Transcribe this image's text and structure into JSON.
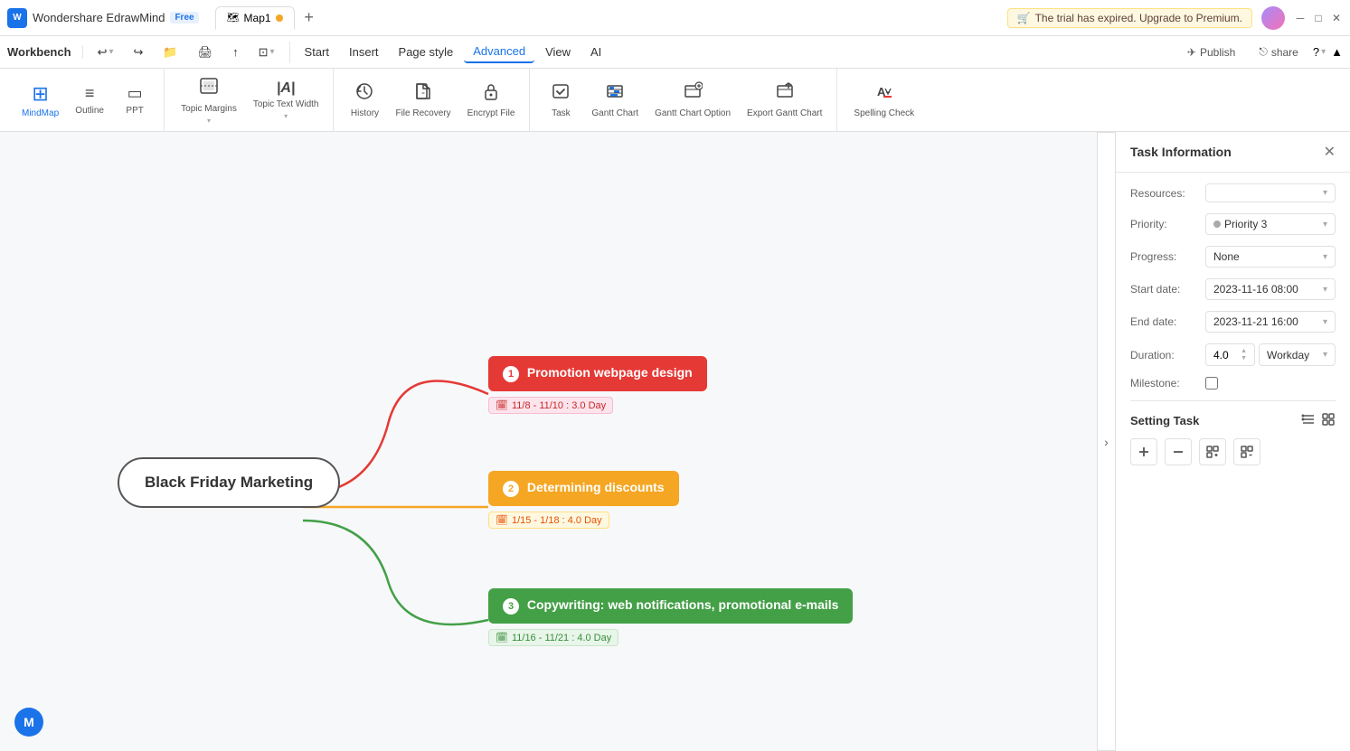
{
  "app": {
    "name": "Wondershare EdrawMind",
    "badge": "Free",
    "tab": "Map1",
    "trial_text": "The trial has expired. Upgrade to Premium."
  },
  "menubar": {
    "items": [
      "Start",
      "Insert",
      "Page style",
      "Advanced",
      "View",
      "AI"
    ],
    "active": "Advanced",
    "publish": "Publish",
    "share": "share"
  },
  "toolbar": {
    "view_group": [
      {
        "id": "mindmap",
        "icon": "⊞",
        "label": "MindMap"
      },
      {
        "id": "outline",
        "icon": "≡",
        "label": "Outline"
      },
      {
        "id": "ppt",
        "icon": "▭",
        "label": "PPT"
      }
    ],
    "format_group": [
      {
        "id": "topic-margins",
        "icon": "⊞",
        "label": "Topic Margins"
      },
      {
        "id": "topic-text-width",
        "icon": "|A|",
        "label": "Topic Text Width"
      }
    ],
    "file_group": [
      {
        "id": "history",
        "icon": "⟳",
        "label": "History"
      },
      {
        "id": "file-recovery",
        "icon": "🗂",
        "label": "File Recovery"
      },
      {
        "id": "encrypt-file",
        "icon": "🔒",
        "label": "Encrypt File"
      }
    ],
    "task_group": [
      {
        "id": "task",
        "icon": "☑",
        "label": "Task"
      },
      {
        "id": "gantt-chart",
        "icon": "📊",
        "label": "Gantt Chart"
      },
      {
        "id": "gantt-chart-option",
        "icon": "⚙",
        "label": "Gantt Chart Option"
      },
      {
        "id": "export-gantt-chart",
        "icon": "↗",
        "label": "Export Gantt Chart"
      }
    ],
    "check_group": [
      {
        "id": "spelling-check",
        "icon": "✓",
        "label": "Spelling Check"
      }
    ]
  },
  "mindmap": {
    "central_node": "Black Friday Marketing",
    "branches": [
      {
        "id": "branch1",
        "label": "Promotion webpage design",
        "color": "red",
        "num": "1",
        "date": "11/8 - 11/10 : 3.0 Day",
        "date_style": "red-bg"
      },
      {
        "id": "branch2",
        "label": "Determining discounts",
        "color": "orange",
        "num": "2",
        "date": "1/15 - 1/18 : 4.0 Day",
        "date_style": "orange-bg"
      },
      {
        "id": "branch3",
        "label": "Copywriting: web notifications, promotional e-mails",
        "color": "green",
        "num": "3",
        "date": "11/16 - 11/21 : 4.0 Day",
        "date_style": "green"
      }
    ]
  },
  "task_panel": {
    "title": "Task Information",
    "fields": [
      {
        "label": "Resources:",
        "value": "",
        "id": "resources"
      },
      {
        "label": "Priority:",
        "value": "Priority 3",
        "id": "priority"
      },
      {
        "label": "Progress:",
        "value": "None",
        "id": "progress"
      },
      {
        "label": "Start date:",
        "value": "2023-11-16   08:00",
        "id": "start-date"
      },
      {
        "label": "End date:",
        "value": "2023-11-21   16:00",
        "id": "end-date"
      },
      {
        "label": "Duration:",
        "value": "4.0",
        "id": "duration",
        "extra": "Workday"
      },
      {
        "label": "Milestone:",
        "value": "",
        "id": "milestone",
        "is_checkbox": true
      }
    ],
    "setting_task_label": "Setting Task",
    "setting_icons": [
      "≡",
      "⊡"
    ],
    "setting_buttons": [
      "+",
      "-",
      "⊞",
      "⊟"
    ]
  },
  "workbench": {
    "label": "Workbench"
  }
}
